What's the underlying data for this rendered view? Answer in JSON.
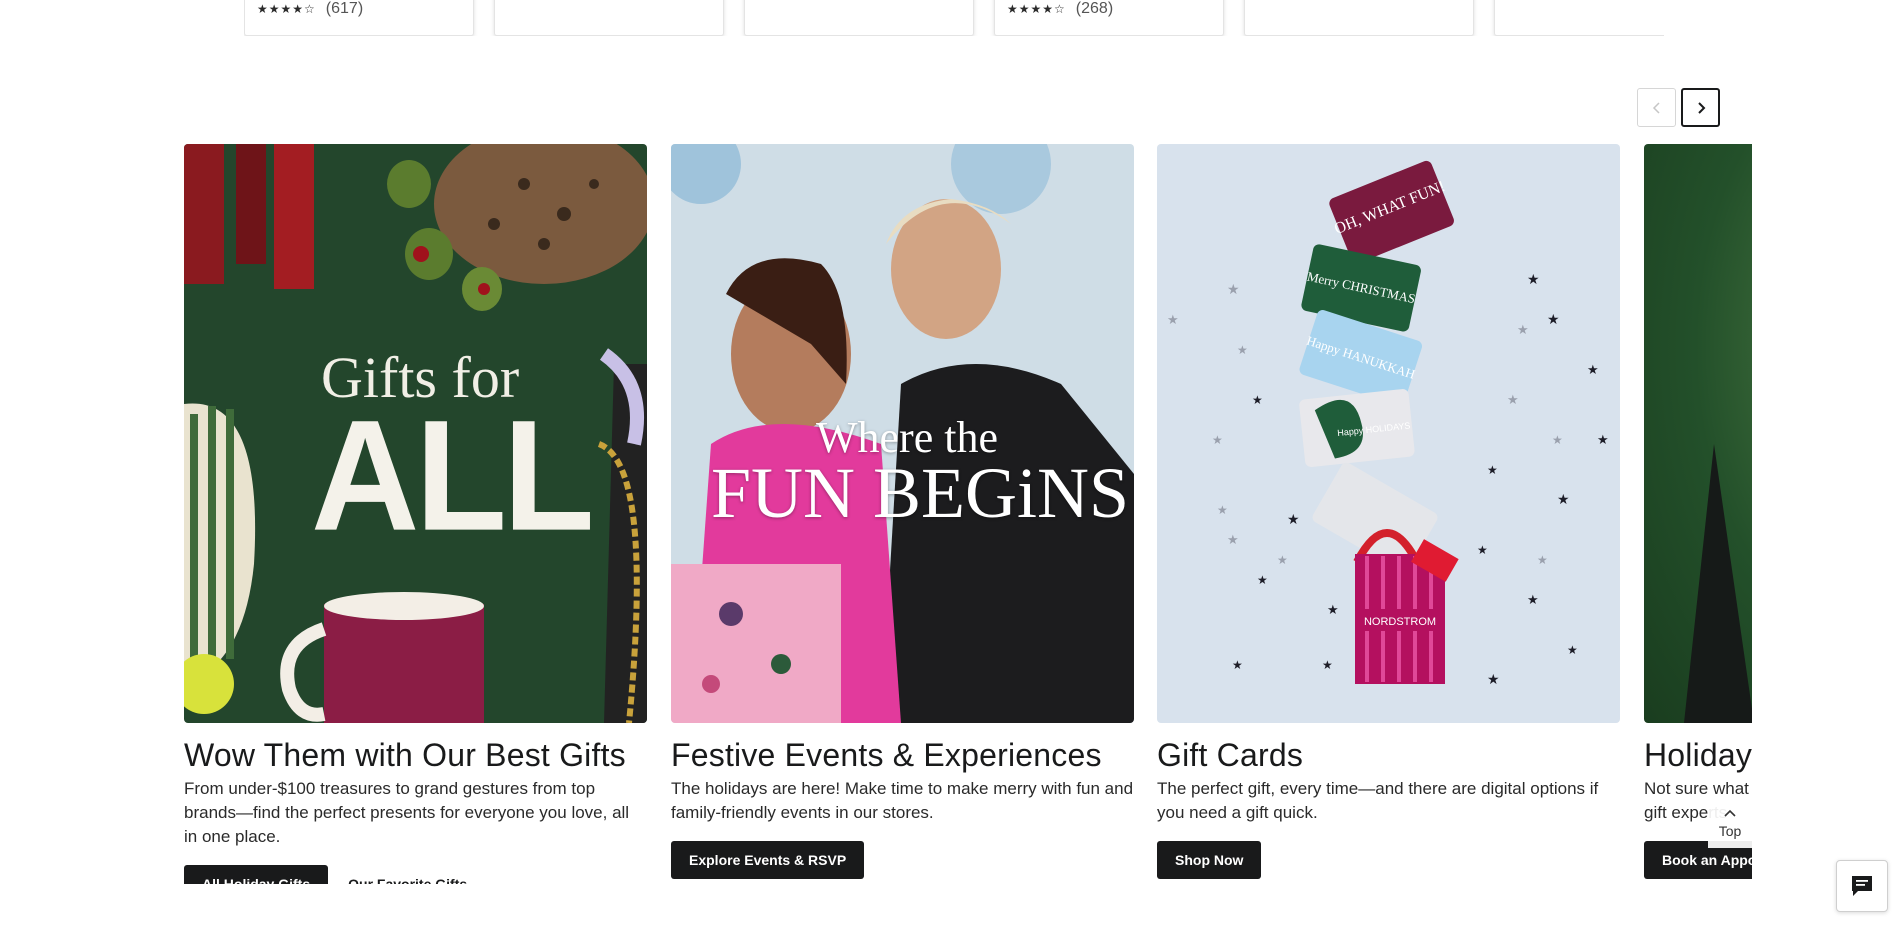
{
  "product_cards": [
    {
      "stars": "★★★★☆",
      "count": "(617)"
    },
    {
      "stars": "",
      "count": ""
    },
    {
      "stars": "",
      "count": ""
    },
    {
      "stars": "★★★★☆",
      "count": "(268)"
    },
    {
      "stars": "",
      "count": ""
    },
    {
      "stars": "",
      "count": ""
    }
  ],
  "carousel": {
    "prev_icon": "chevron-left-icon",
    "next_icon": "chevron-right-icon"
  },
  "promos": [
    {
      "image_text_line1": "Gifts for",
      "image_text_line2": "ALL",
      "title": "Wow Them with Our Best Gifts",
      "description": "From under-$100 treasures to grand gestures from top brands—find the perfect presents for everyone you love, all in one place.",
      "primary_cta": "All Holiday Gifts",
      "secondary_link": "Our Favorite Gifts"
    },
    {
      "image_text_line1": "Where the",
      "image_text_line2": "FUN BEGiNS!",
      "title": "Festive Events & Experiences",
      "description": "The holidays are here! Make time to make merry with fun and family-friendly events in our stores.",
      "primary_cta": "Explore Events & RSVP"
    },
    {
      "card1": "OH, WHAT FUN!",
      "card2": "Merry CHRISTMAS",
      "card3": "Happy HANUKKAH",
      "card4": "Happy HOLIDAYS",
      "bag": "NORDSTROM",
      "title": "Gift Cards",
      "description": "The perfect gift, every time—and there are digital options if you need a gift quick.",
      "primary_cta": "Shop Now"
    },
    {
      "title": "Holiday G",
      "description": "Not sure what t our gift experts",
      "primary_cta": "Book an Appoi"
    }
  ],
  "back_to_top": {
    "label": "Top"
  },
  "chat": {
    "icon": "chat-icon"
  },
  "colors": {
    "primary": "#191a1b",
    "promo1_bg": "#23462c",
    "promo3_bg": "#d8e2ed"
  }
}
